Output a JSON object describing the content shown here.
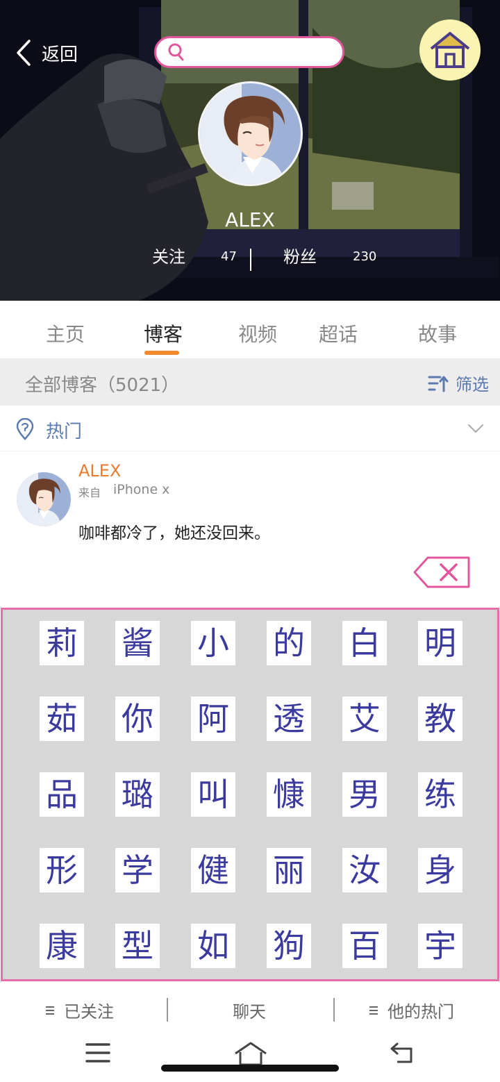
{
  "header": {
    "back_label": "返回",
    "search_placeholder": "",
    "username": "ALEX",
    "following_label": "关注",
    "following_count": "47",
    "followers_label": "粉丝",
    "followers_count": "230"
  },
  "tabs": [
    {
      "label": "主页",
      "active": false
    },
    {
      "label": "博客",
      "active": true
    },
    {
      "label": "视频",
      "active": false
    },
    {
      "label": "超话",
      "active": false
    },
    {
      "label": "故事",
      "active": false
    }
  ],
  "filter_bar": {
    "all_blogs_label": "全部博客（5021）",
    "filter_label": "筛选"
  },
  "hot_row": {
    "label": "热门"
  },
  "post": {
    "author": "ALEX",
    "from_label": "来自",
    "device": "iPhone x",
    "text": "咖啡都冷了，她还没回来。"
  },
  "keyboard": {
    "rows": [
      [
        "莉",
        "酱",
        "小",
        "的",
        "白",
        "明"
      ],
      [
        "茹",
        "你",
        "阿",
        "透",
        "艾",
        "教"
      ],
      [
        "品",
        "璐",
        "叫",
        "慷",
        "男",
        "练"
      ],
      [
        "形",
        "学",
        "健",
        "丽",
        "汝",
        "身"
      ],
      [
        "康",
        "型",
        "如",
        "狗",
        "百",
        "宇"
      ]
    ]
  },
  "action_bar": {
    "followed_label": "已关注",
    "chat_label": "聊天",
    "his_hot_label": "他的热门"
  },
  "colors": {
    "accent_orange": "#f08a2c",
    "link_blue": "#5b7ab0",
    "keyboard_border": "#e66fab",
    "key_text": "#3b3a9e",
    "home_button_bg": "#fbf3b2"
  },
  "icons": {
    "back": "chevron-left-icon",
    "search": "search-icon",
    "home": "house-icon",
    "filter": "sort-up-icon",
    "hot": "location-pin-icon",
    "expand": "chevron-down-icon",
    "delete": "backspace-icon",
    "menu": "hamburger-icon",
    "nav_home": "house-outline-icon",
    "nav_back": "return-arrow-icon"
  }
}
